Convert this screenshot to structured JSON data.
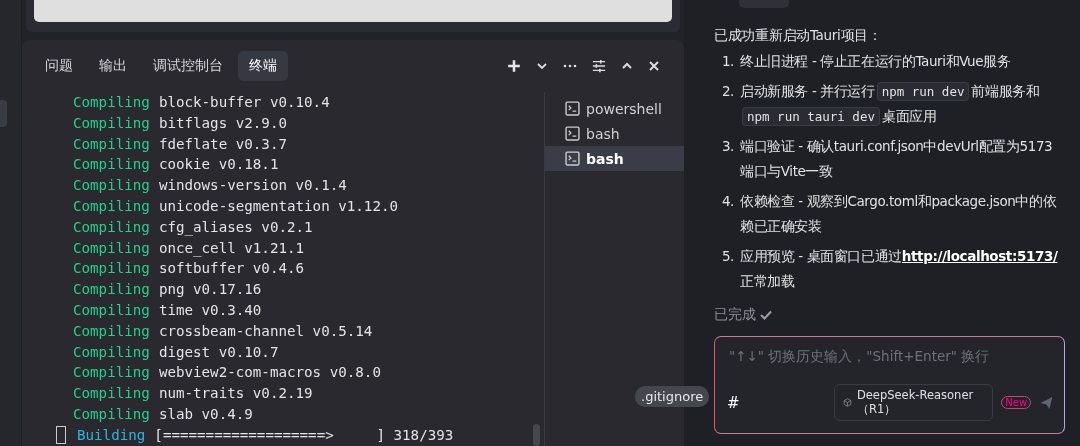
{
  "panel_tabs": [
    {
      "label": "问题",
      "selected": false
    },
    {
      "label": "输出",
      "selected": false
    },
    {
      "label": "调试控制台",
      "selected": false
    },
    {
      "label": "终端",
      "selected": true
    }
  ],
  "terminal": {
    "lines": [
      {
        "kind": "compile",
        "status": "Compiling",
        "text": "block-buffer v0.10.4"
      },
      {
        "kind": "compile",
        "status": "Compiling",
        "text": "bitflags v2.9.0"
      },
      {
        "kind": "compile",
        "status": "Compiling",
        "text": "fdeflate v0.3.7"
      },
      {
        "kind": "compile",
        "status": "Compiling",
        "text": "cookie v0.18.1"
      },
      {
        "kind": "compile",
        "status": "Compiling",
        "text": "windows-version v0.1.4"
      },
      {
        "kind": "compile",
        "status": "Compiling",
        "text": "unicode-segmentation v1.12.0"
      },
      {
        "kind": "compile",
        "status": "Compiling",
        "text": "cfg_aliases v0.2.1"
      },
      {
        "kind": "compile",
        "status": "Compiling",
        "text": "once_cell v1.21.1"
      },
      {
        "kind": "compile",
        "status": "Compiling",
        "text": "softbuffer v0.4.6"
      },
      {
        "kind": "compile",
        "status": "Compiling",
        "text": "png v0.17.16"
      },
      {
        "kind": "compile",
        "status": "Compiling",
        "text": "time v0.3.40"
      },
      {
        "kind": "compile",
        "status": "Compiling",
        "text": "crossbeam-channel v0.5.14"
      },
      {
        "kind": "compile",
        "status": "Compiling",
        "text": "digest v0.10.7"
      },
      {
        "kind": "compile",
        "status": "Compiling",
        "text": "webview2-com-macros v0.8.0"
      },
      {
        "kind": "compile",
        "status": "Compiling",
        "text": "num-traits v0.2.19"
      },
      {
        "kind": "compile",
        "status": "Compiling",
        "text": "slab v0.4.9"
      },
      {
        "kind": "build",
        "status": "Building",
        "text": "[===================>     ] 318/393"
      }
    ]
  },
  "terminal_list": [
    {
      "label": "powershell",
      "selected": false
    },
    {
      "label": "bash",
      "selected": false
    },
    {
      "label": "bash",
      "selected": true
    }
  ],
  "tooltip": ".gitignore",
  "chat": {
    "intro": "已成功重新启动Tauri项目：",
    "steps": [
      {
        "number": "1.",
        "parts": [
          {
            "kind": "text",
            "text": "终止旧进程 - 停止正在运行的Tauri和Vue服务"
          }
        ]
      },
      {
        "number": "2.",
        "parts": [
          {
            "kind": "text",
            "text": "启动新服务 - 并行运行"
          },
          {
            "kind": "code",
            "text": "npm run dev"
          },
          {
            "kind": "text",
            "text": "前端服务和"
          },
          {
            "kind": "code",
            "text": "npm run tauri dev"
          },
          {
            "kind": "text",
            "text": "桌面应用"
          }
        ]
      },
      {
        "number": "3.",
        "parts": [
          {
            "kind": "text",
            "text": "端口验证 - 确认tauri.conf.json中devUrl配置为5173端口与Vite一致"
          }
        ]
      },
      {
        "number": "4.",
        "parts": [
          {
            "kind": "text",
            "text": "依赖检查 - 观察到Cargo.toml和package.json中的依赖已正确安装"
          }
        ]
      },
      {
        "number": "5.",
        "parts": [
          {
            "kind": "text",
            "text": "应用预览 - 桌面窗口已通过"
          },
          {
            "kind": "link",
            "text": "http://localhost:5173/"
          },
          {
            "kind": "text",
            "text": "正常加载"
          }
        ]
      }
    ],
    "status": "已完成",
    "input": {
      "placeholder": "\"↑↓\" 切换历史输入，\"Shift+Enter\" 换行",
      "hash": "#",
      "model": "DeepSeek-Reasoner（R1）",
      "badge": "New"
    }
  }
}
